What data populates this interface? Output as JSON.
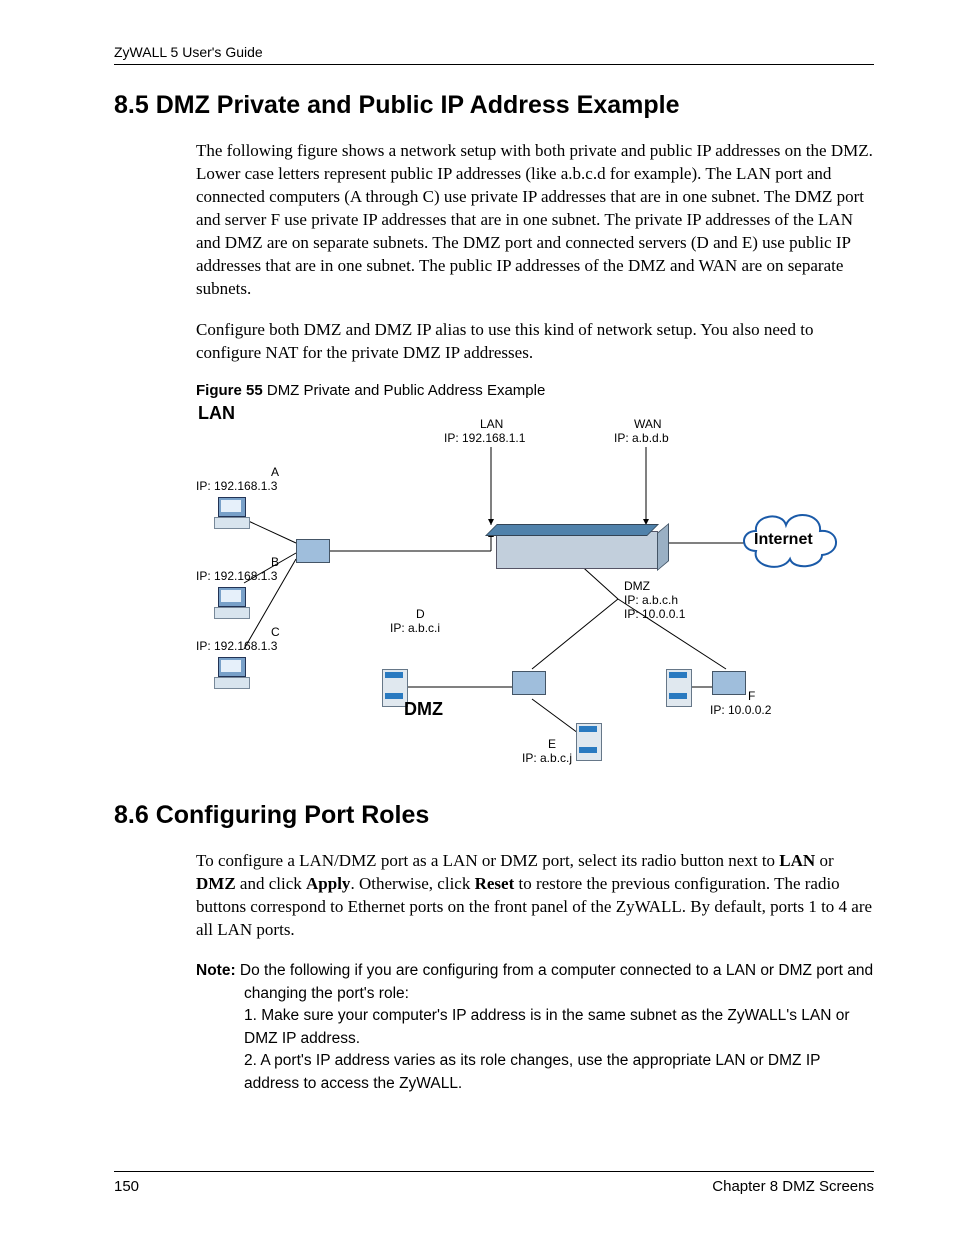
{
  "doc": {
    "running_header": "ZyWALL 5 User's Guide",
    "page_number": "150",
    "footer_right": "Chapter 8 DMZ Screens"
  },
  "sec85": {
    "title": "8.5  DMZ Private and Public IP Address Example",
    "p1": "The following figure shows a network setup with both private and public IP addresses on the DMZ.  Lower case letters represent public IP addresses (like a.b.c.d for example). The LAN port and connected computers (A through C) use private IP addresses that are in one subnet. The DMZ port and server F use private IP addresses that are in one subnet.  The private IP addresses of the LAN and DMZ are on separate subnets. The DMZ port and connected servers (D and E) use public IP addresses that are in one subnet. The public IP addresses of the DMZ and WAN are on separate subnets.",
    "p2": "Configure both DMZ and DMZ IP alias to use this kind of network setup. You also need to configure NAT for the private DMZ IP addresses.",
    "fig_caption_bold": "Figure 55",
    "fig_caption_rest": "   DMZ Private and Public Address Example"
  },
  "diagram": {
    "lan_section": "LAN",
    "dmz_section": "DMZ",
    "internet": "Internet",
    "hosts": {
      "A": {
        "name": "A",
        "ip": "IP: 192.168.1.3"
      },
      "B": {
        "name": "B",
        "ip": "IP: 192.168.1.3"
      },
      "C": {
        "name": "C",
        "ip": "IP: 192.168.1.3"
      },
      "D": {
        "name": "D",
        "ip": "IP: a.b.c.i"
      },
      "E": {
        "name": "E",
        "ip": "IP: a.b.c.j"
      },
      "F": {
        "name": "F",
        "ip": "IP: 10.0.0.2"
      }
    },
    "ports": {
      "lan": {
        "name": "LAN",
        "ip": "IP: 192.168.1.1"
      },
      "wan": {
        "name": "WAN",
        "ip": "IP: a.b.d.b"
      },
      "dmz": {
        "name": "DMZ",
        "ip_pub": "IP: a.b.c.h",
        "ip_priv": "IP: 10.0.0.1"
      }
    }
  },
  "sec86": {
    "title": "8.6  Configuring Port Roles",
    "p1_a": "To configure a LAN/DMZ port as a LAN or DMZ port, select its radio button next to ",
    "p1_lan": "LAN",
    "p1_b": " or ",
    "p1_dmz": "DMZ",
    "p1_c": " and click ",
    "p1_apply": "Apply",
    "p1_d": ". Otherwise, click ",
    "p1_reset": "Reset",
    "p1_e": " to restore the previous configuration. The radio buttons correspond to Ethernet ports on the front panel of the ZyWALL. By default, ports 1 to 4 are all LAN ports.",
    "note_label": "Note: ",
    "note_l1": "Do the following if you are configuring from a computer connected to a LAN or DMZ port and changing the port's role:",
    "note_l2": "1. Make sure your computer's IP address is in the same subnet as the ZyWALL's LAN or DMZ IP address.",
    "note_l3": "2. A port's IP address varies as its role changes, use the appropriate LAN or DMZ IP address to access the ZyWALL."
  }
}
